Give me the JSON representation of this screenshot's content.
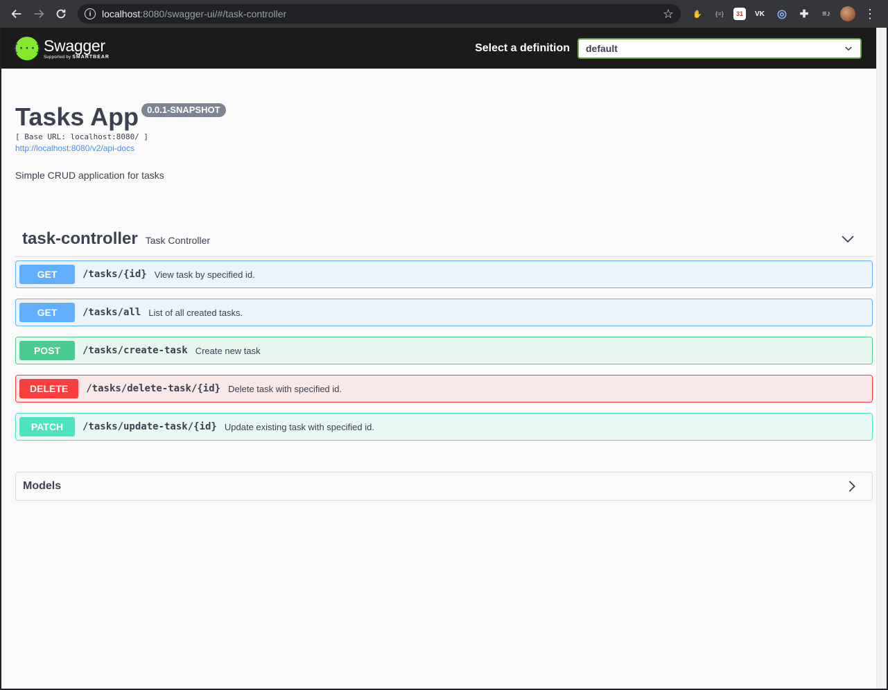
{
  "browser": {
    "url_host": "localhost",
    "url_rest": ":8080/swagger-ui/#/task-controller",
    "info_glyph": "i",
    "bookmark_glyph": "☆",
    "menu_glyph": "⋮",
    "extensions": [
      {
        "icon": "hand-stop-icon",
        "glyph": "✋",
        "color": "#e53935"
      },
      {
        "icon": "json-braces-icon",
        "glyph": "{≡}",
        "color": "#5f6368"
      },
      {
        "icon": "calendar-icon",
        "glyph": "31",
        "color": "#d93025"
      },
      {
        "icon": "vk-icon",
        "glyph": "VK",
        "color": "#202124"
      },
      {
        "icon": "globe-icon",
        "glyph": "◎",
        "color": "#8ab4f8"
      },
      {
        "icon": "puzzle-icon",
        "glyph": "✚",
        "color": "#e8eaed"
      },
      {
        "icon": "playlist-icon",
        "glyph": "≡♪",
        "color": "#e8eaed"
      }
    ]
  },
  "swagger": {
    "logo_mark": "{···}",
    "logo_title": "Swagger",
    "logo_sub_prefix": "Supported by",
    "logo_sub_brand": "SMARTBEAR",
    "definition_label": "Select a definition",
    "definition_value": "default"
  },
  "info": {
    "title": "Tasks App",
    "version": "0.0.1-SNAPSHOT",
    "base_url": "[ Base URL: localhost:8080/ ]",
    "docs_link": "http://localhost:8080/v2/api-docs",
    "description": "Simple CRUD application for tasks"
  },
  "tag": {
    "name": "task-controller",
    "description": "Task Controller"
  },
  "operations": [
    {
      "method": "GET",
      "path": "/tasks/{id}",
      "summary": "View task by specified id."
    },
    {
      "method": "GET",
      "path": "/tasks/all",
      "summary": "List of all created tasks."
    },
    {
      "method": "POST",
      "path": "/tasks/create-task",
      "summary": "Create new task"
    },
    {
      "method": "DELETE",
      "path": "/tasks/delete-task/{id}",
      "summary": "Delete task with specified id."
    },
    {
      "method": "PATCH",
      "path": "/tasks/update-task/{id}",
      "summary": "Update existing task with specified id."
    }
  ],
  "models": {
    "title": "Models"
  },
  "colors": {
    "get": "#61affe",
    "post": "#49cc90",
    "delete": "#f93e3e",
    "patch": "#50e3c2",
    "swagger_green": "#85ea2d",
    "topbar": "#1b1b1b"
  }
}
